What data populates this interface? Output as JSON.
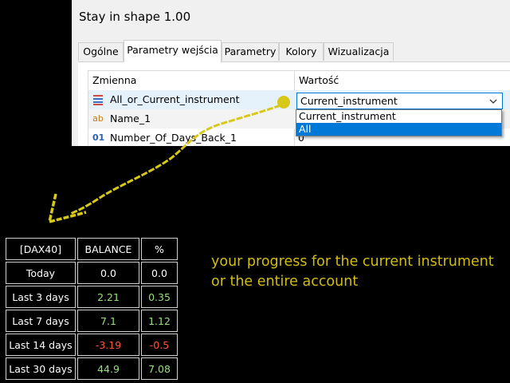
{
  "dialog": {
    "title": "Stay in shape 1.00",
    "tabs": [
      {
        "label": "Ogólne",
        "active": false
      },
      {
        "label": "Parametry wejścia",
        "active": true
      },
      {
        "label": "Parametry",
        "active": false
      },
      {
        "label": "Kolory",
        "active": false
      },
      {
        "label": "Wizualizacja",
        "active": false
      }
    ],
    "grid": {
      "col_variable": "Zmienna",
      "col_value": "Wartość",
      "rows": [
        {
          "icon": "enum-list-icon",
          "name": "All_or_Current_instrument",
          "value": "Current_instrument"
        },
        {
          "icon": "string-ab-icon",
          "name": "Name_1",
          "value": ""
        },
        {
          "icon": "integer-01-icon",
          "name": "Number_Of_Days_Back_1",
          "value": "0"
        }
      ]
    },
    "dropdown": {
      "selected": "Current_instrument",
      "options": [
        "Current_instrument",
        "All"
      ],
      "highlighted_index": 1
    }
  },
  "stats": {
    "headers": [
      "[DAX40]",
      "BALANCE",
      "%"
    ],
    "rows": [
      {
        "label": "Today",
        "balance": "0.0",
        "pct": "0.0",
        "trend": "neutral"
      },
      {
        "label": "Last 3 days",
        "balance": "2.21",
        "pct": "0.35",
        "trend": "positive"
      },
      {
        "label": "Last 7 days",
        "balance": "7.1",
        "pct": "1.12",
        "trend": "positive"
      },
      {
        "label": "Last 14 days",
        "balance": "-3.19",
        "pct": "-0.5",
        "trend": "negative"
      },
      {
        "label": "Last 30 days",
        "balance": "44.9",
        "pct": "7.08",
        "trend": "positive"
      }
    ]
  },
  "note": {
    "text": "your progress for the current instrument or the entire account"
  },
  "colors": {
    "background": "#000000",
    "arrow": "#d8c81a",
    "note_text": "#d2bd10",
    "positive": "#98e07a",
    "negative": "#ff5533",
    "selection": "#0078d7"
  }
}
